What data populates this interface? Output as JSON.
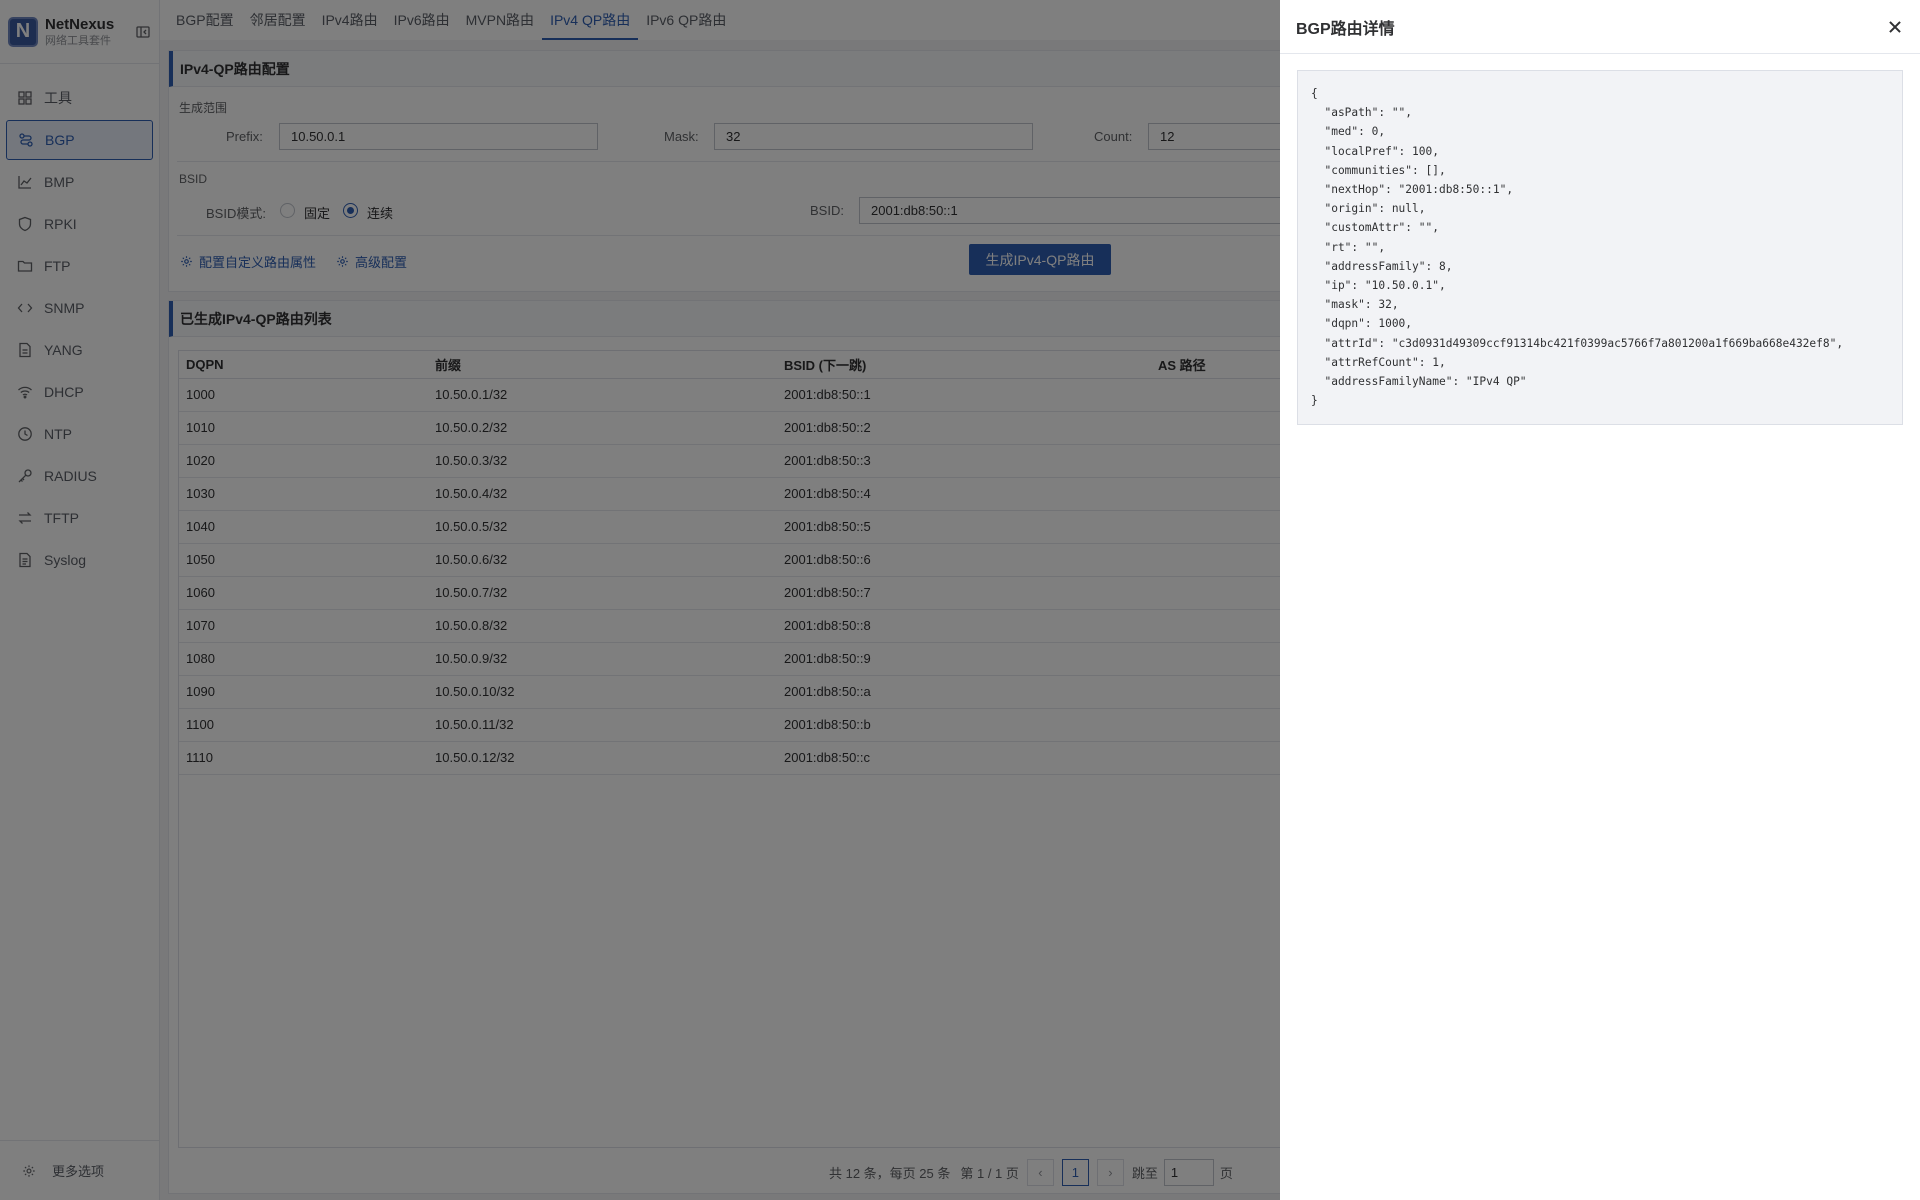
{
  "app": {
    "name": "NetNexus",
    "subtitle": "网络工具套件"
  },
  "sidebar": {
    "items": [
      {
        "label": "工具",
        "icon": "grid-icon"
      },
      {
        "label": "BGP",
        "icon": "route-icon",
        "active": true
      },
      {
        "label": "BMP",
        "icon": "chart-icon"
      },
      {
        "label": "RPKI",
        "icon": "shield-icon"
      },
      {
        "label": "FTP",
        "icon": "folder-icon"
      },
      {
        "label": "SNMP",
        "icon": "code-icon"
      },
      {
        "label": "YANG",
        "icon": "file-icon"
      },
      {
        "label": "DHCP",
        "icon": "wifi-icon"
      },
      {
        "label": "NTP",
        "icon": "clock-icon"
      },
      {
        "label": "RADIUS",
        "icon": "key-icon"
      },
      {
        "label": "TFTP",
        "icon": "transfer-icon"
      },
      {
        "label": "Syslog",
        "icon": "log-icon"
      }
    ],
    "footer_label": "更多选项"
  },
  "tabs": [
    {
      "label": "BGP配置"
    },
    {
      "label": "邻居配置"
    },
    {
      "label": "IPv4路由"
    },
    {
      "label": "IPv6路由"
    },
    {
      "label": "MVPN路由"
    },
    {
      "label": "IPv4 QP路由",
      "active": true
    },
    {
      "label": "IPv6 QP路由"
    }
  ],
  "config": {
    "title": "IPv4-QP路由配置",
    "range_label": "生成范围",
    "prefix_label": "Prefix:",
    "prefix_value": "10.50.0.1",
    "mask_label": "Mask:",
    "mask_value": "32",
    "count_label": "Count:",
    "count_value": "12",
    "bsid_section_label": "BSID",
    "bsid_mode_label": "BSID模式:",
    "mode_fixed": "固定",
    "mode_continuous": "连续",
    "bsid_label": "BSID:",
    "bsid_value": "2001:db8:50::1",
    "custom_attr_link": "配置自定义路由属性",
    "advanced_link": "高级配置",
    "generate_button": "生成IPv4-QP路由"
  },
  "list": {
    "title": "已生成IPv4-QP路由列表",
    "columns": [
      "DQPN",
      "前缀",
      "BSID (下一跳)",
      "AS 路径"
    ],
    "rows": [
      [
        "1000",
        "10.50.0.1/32",
        "2001:db8:50::1"
      ],
      [
        "1010",
        "10.50.0.2/32",
        "2001:db8:50::2"
      ],
      [
        "1020",
        "10.50.0.3/32",
        "2001:db8:50::3"
      ],
      [
        "1030",
        "10.50.0.4/32",
        "2001:db8:50::4"
      ],
      [
        "1040",
        "10.50.0.5/32",
        "2001:db8:50::5"
      ],
      [
        "1050",
        "10.50.0.6/32",
        "2001:db8:50::6"
      ],
      [
        "1060",
        "10.50.0.7/32",
        "2001:db8:50::7"
      ],
      [
        "1070",
        "10.50.0.8/32",
        "2001:db8:50::8"
      ],
      [
        "1080",
        "10.50.0.9/32",
        "2001:db8:50::9"
      ],
      [
        "1090",
        "10.50.0.10/32",
        "2001:db8:50::a"
      ],
      [
        "1100",
        "10.50.0.11/32",
        "2001:db8:50::b"
      ],
      [
        "1110",
        "10.50.0.12/32",
        "2001:db8:50::c"
      ]
    ],
    "pagination": {
      "summary": "共 12 条，每页 25 条",
      "page_info": "第 1 / 1 页",
      "current_page": "1",
      "prev": "‹",
      "next": "›",
      "goto_label": "跳至",
      "goto_value": "1",
      "page_suffix": "页"
    }
  },
  "drawer": {
    "title": "BGP路由详情",
    "close": "×",
    "json_text": "{\n  \"asPath\": \"\",\n  \"med\": 0,\n  \"localPref\": 100,\n  \"communities\": [],\n  \"nextHop\": \"2001:db8:50::1\",\n  \"origin\": null,\n  \"customAttr\": \"\",\n  \"rt\": \"\",\n  \"addressFamily\": 8,\n  \"ip\": \"10.50.0.1\",\n  \"mask\": 32,\n  \"dqpn\": 1000,\n  \"attrId\": \"c3d0931d49309ccf91314bc421f0399ac5766f7a801200a1f669ba668e432ef8\",\n  \"attrRefCount\": 1,\n  \"addressFamilyName\": \"IPv4 QP\"\n}"
  },
  "colors": {
    "accent": "#2f5fb3",
    "overlay": "rgba(0,0,0,0.5)"
  }
}
